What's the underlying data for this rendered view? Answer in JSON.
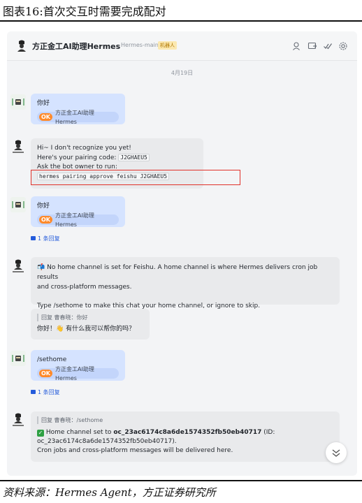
{
  "figure": {
    "title": "图表16:首次交互时需要完成配对",
    "source": "资料来源：Hermes Agent，方正证券研究所"
  },
  "header": {
    "bot_name": "方正金工AI助理Hermes",
    "bot_sub": "Hermes-main",
    "badge": "机器人"
  },
  "date_divider": "4月19日",
  "avatar_caption": "Hermes Agent",
  "chip": {
    "ok": "OK",
    "label": "方正金工AI助理Hermes"
  },
  "messages": {
    "m1_text": "你好",
    "m2_line1": "Hi~ I don't recognize you yet!",
    "m2_line2_prefix": "Here's your pairing code:",
    "m2_code": "J2GHAEU5",
    "m2_line3": "Ask the bot owner to run:",
    "m2_command": "hermes pairing approve feishu J2GHAEU5",
    "m3_text": "你好",
    "m3_reply_count": "1 条回复",
    "m4_line1": "No home channel is set for Feishu. A home channel is where Hermes delivers cron job results",
    "m4_line2": "and cross-platform messages.",
    "m4_line3": "Type /sethome to make this chat your home channel, or ignore to skip.",
    "m5_quote": "回复 曹春晓：你好",
    "m5_text": "你好！👋 有什么我可以帮你的吗？",
    "m6_text": "/sethome",
    "m6_reply_count": "1 条回复",
    "m7_quote": "回复 曹春晓：/sethome",
    "m7_line1_prefix": "Home channel set to",
    "m7_line1_id": "oc_23ac6174c8a6de1574352fb50eb40717",
    "m7_line1_suffix": "(ID:",
    "m7_line2": "oc_23ac6174c8a6de1574352fb50eb40717).",
    "m7_line3": "Cron jobs and cross-platform messages will be delivered here."
  },
  "colors": {
    "user_bubble": "#d5e3ff",
    "bot_bubble": "#e9eaec",
    "ok_badge": "#ff8a2a",
    "link": "#245bdb",
    "highlight_box": "#e0312a"
  }
}
